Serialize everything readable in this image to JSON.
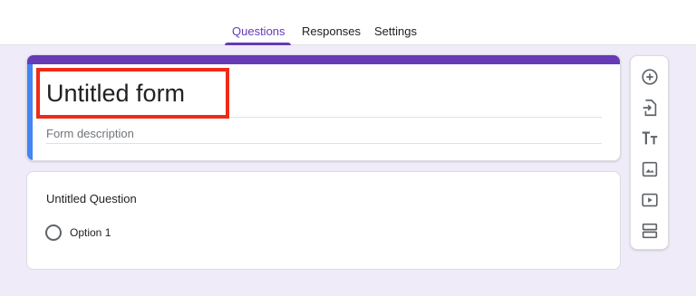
{
  "tabs": [
    {
      "label": "Questions"
    },
    {
      "label": "Responses"
    },
    {
      "label": "Settings"
    }
  ],
  "form": {
    "title": "Untitled form",
    "description_placeholder": "Form description"
  },
  "question": {
    "title": "Untitled Question",
    "options": [
      {
        "label": "Option 1"
      }
    ]
  },
  "toolbar": {
    "icons": [
      "add-question-icon",
      "import-questions-icon",
      "add-title-icon",
      "add-image-icon",
      "add-video-icon",
      "add-section-icon"
    ]
  },
  "colors": {
    "accent": "#673ab7",
    "focus": "#4285f4",
    "highlight": "#ef2b16",
    "background": "#f0ebf8"
  }
}
